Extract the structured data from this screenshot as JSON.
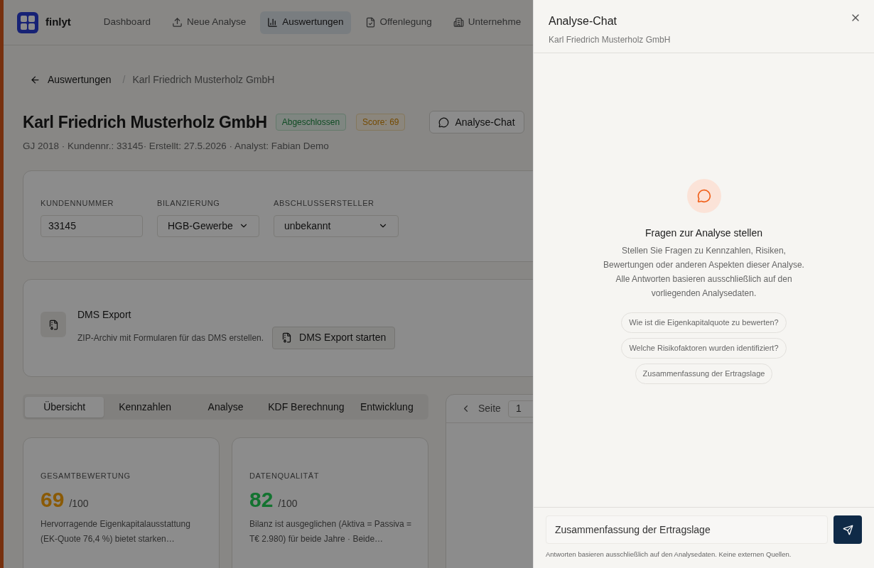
{
  "nav": {
    "logo": "finlyt",
    "items": [
      {
        "label": "Dashboard",
        "selected": false
      },
      {
        "label": "Neue Analyse",
        "selected": false
      },
      {
        "label": "Auswertungen",
        "selected": true
      },
      {
        "label": "Offenlegung",
        "selected": false
      },
      {
        "label": "Unternehme",
        "selected": false
      }
    ]
  },
  "breadcrumb": {
    "back": "Auswertungen",
    "separator": "/",
    "current": "Karl Friedrich Musterholz GmbH"
  },
  "header": {
    "title": "Karl Friedrich Musterholz GmbH",
    "status": "Abgeschlossen",
    "score": "Score: 69",
    "chat_button": "Analyse-Chat",
    "meta": "GJ 2018 · Kundennr.: 33145· Erstellt: 27.5.2026 · Analyst: Fabian Demo"
  },
  "fields": [
    {
      "label": "KUNDENNUMMER",
      "value": "33145",
      "kind": "input"
    },
    {
      "label": "BILANZIERUNG",
      "value": "HGB-Gewerbe",
      "kind": "select"
    },
    {
      "label": "ABSCHLUSSERSTELLER",
      "value": "unbekannt",
      "kind": "select"
    }
  ],
  "dms": {
    "title": "DMS Export",
    "description": "ZIP-Archiv mit Formularen für das DMS erstellen.",
    "button": "DMS Export starten"
  },
  "tabs": [
    {
      "label": "Übersicht",
      "selected": true
    },
    {
      "label": "Kennzahlen",
      "selected": false
    },
    {
      "label": "Analyse",
      "selected": false
    },
    {
      "label": "KDF Berechnung",
      "selected": false
    },
    {
      "label": "Entwicklung",
      "selected": false
    }
  ],
  "pager": {
    "label": "Seite",
    "value": "1"
  },
  "score_cards": [
    {
      "label": "GESAMTBEWERTUNG",
      "value": "69",
      "suffix": "/100",
      "color": "#8a5a06",
      "text": "Hervorragende Eigenkapitalausstattung (EK-Quote 76,4 %) bietet starken…"
    },
    {
      "label": "DATENQUALITÄT",
      "value": "82",
      "suffix": "/100",
      "color": "#137330",
      "text": "Bilanz ist ausgeglichen (Aktiva = Passiva = T€ 2.980) für beide Jahre · Beide…"
    }
  ],
  "chat": {
    "title": "Analyse-Chat",
    "subtitle": "Karl Friedrich Musterholz GmbH",
    "heading": "Fragen zur Analyse stellen",
    "description": "Stellen Sie Fragen zu Kennzahlen, Risiken, Bewertungen oder anderen Aspekten dieser Analyse. Alle Antworten basieren ausschließlich auf den vorliegenden Analysedaten.",
    "suggestions": [
      "Wie ist die Eigenkapitalquote zu bewerten?",
      "Welche Risikofaktoren wurden identifiziert?",
      "Zusammenfassung der Ertragslage"
    ],
    "input": {
      "value": "Zusammenfassung der Ertragslage"
    },
    "footnote": "Antworten basieren ausschließlich auf den Analysedaten. Keine externen Quellen."
  }
}
